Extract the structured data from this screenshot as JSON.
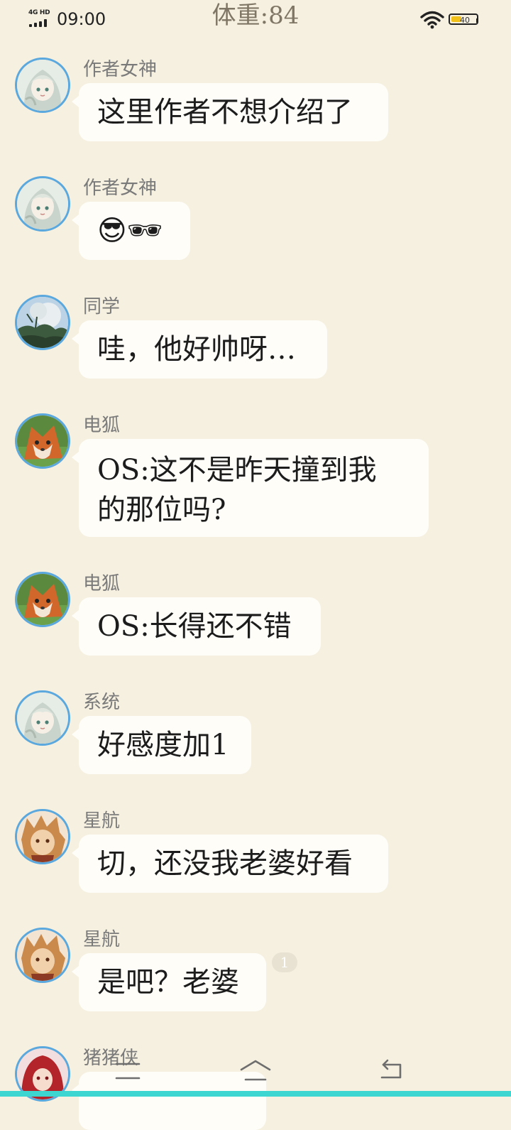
{
  "status_bar": {
    "network": "4G HD",
    "time": "09:00",
    "title": "体重:84",
    "battery_level": "40",
    "battery_fraction": 0.4,
    "colors": {
      "battery_fill": "#f2c119",
      "text": "#222222"
    }
  },
  "theme": {
    "background": "#f6f0e0",
    "bubble": "#fefdf8",
    "avatar_ring": "#5aa8de",
    "nav_accent": "#3dd6d0"
  },
  "messages": [
    {
      "sender": "作者女神",
      "avatar": "silver-hair-girl-avatar",
      "lines": [
        "这里作者不想介绍了"
      ]
    },
    {
      "sender": "作者女神",
      "avatar": "silver-hair-girl-avatar",
      "lines": [
        "😎🕶"
      ]
    },
    {
      "sender": "同学",
      "avatar": "tree-landscape-avatar",
      "lines": [
        "哇，他好帅呀…"
      ]
    },
    {
      "sender": "电狐",
      "avatar": "orange-fox-avatar",
      "lines": [
        "OS:这不是昨天撞到我",
        "的那位吗?"
      ]
    },
    {
      "sender": "电狐",
      "avatar": "orange-fox-avatar",
      "lines": [
        "OS:长得还不错"
      ]
    },
    {
      "sender": "系统",
      "avatar": "silver-hair-girl-avatar",
      "lines": [
        "好感度加1"
      ]
    },
    {
      "sender": "星航",
      "avatar": "lion-character-avatar",
      "lines": [
        "切，还没我老婆好看"
      ]
    },
    {
      "sender": "星航",
      "avatar": "lion-character-avatar",
      "lines": [
        "是吧？老婆"
      ],
      "badge": "1"
    },
    {
      "sender": "猪猪侠",
      "avatar": "red-hood-character-avatar",
      "lines": [
        ""
      ]
    }
  ],
  "nav_bar": {
    "icons": [
      "menu-icon",
      "home-icon",
      "back-icon"
    ]
  }
}
